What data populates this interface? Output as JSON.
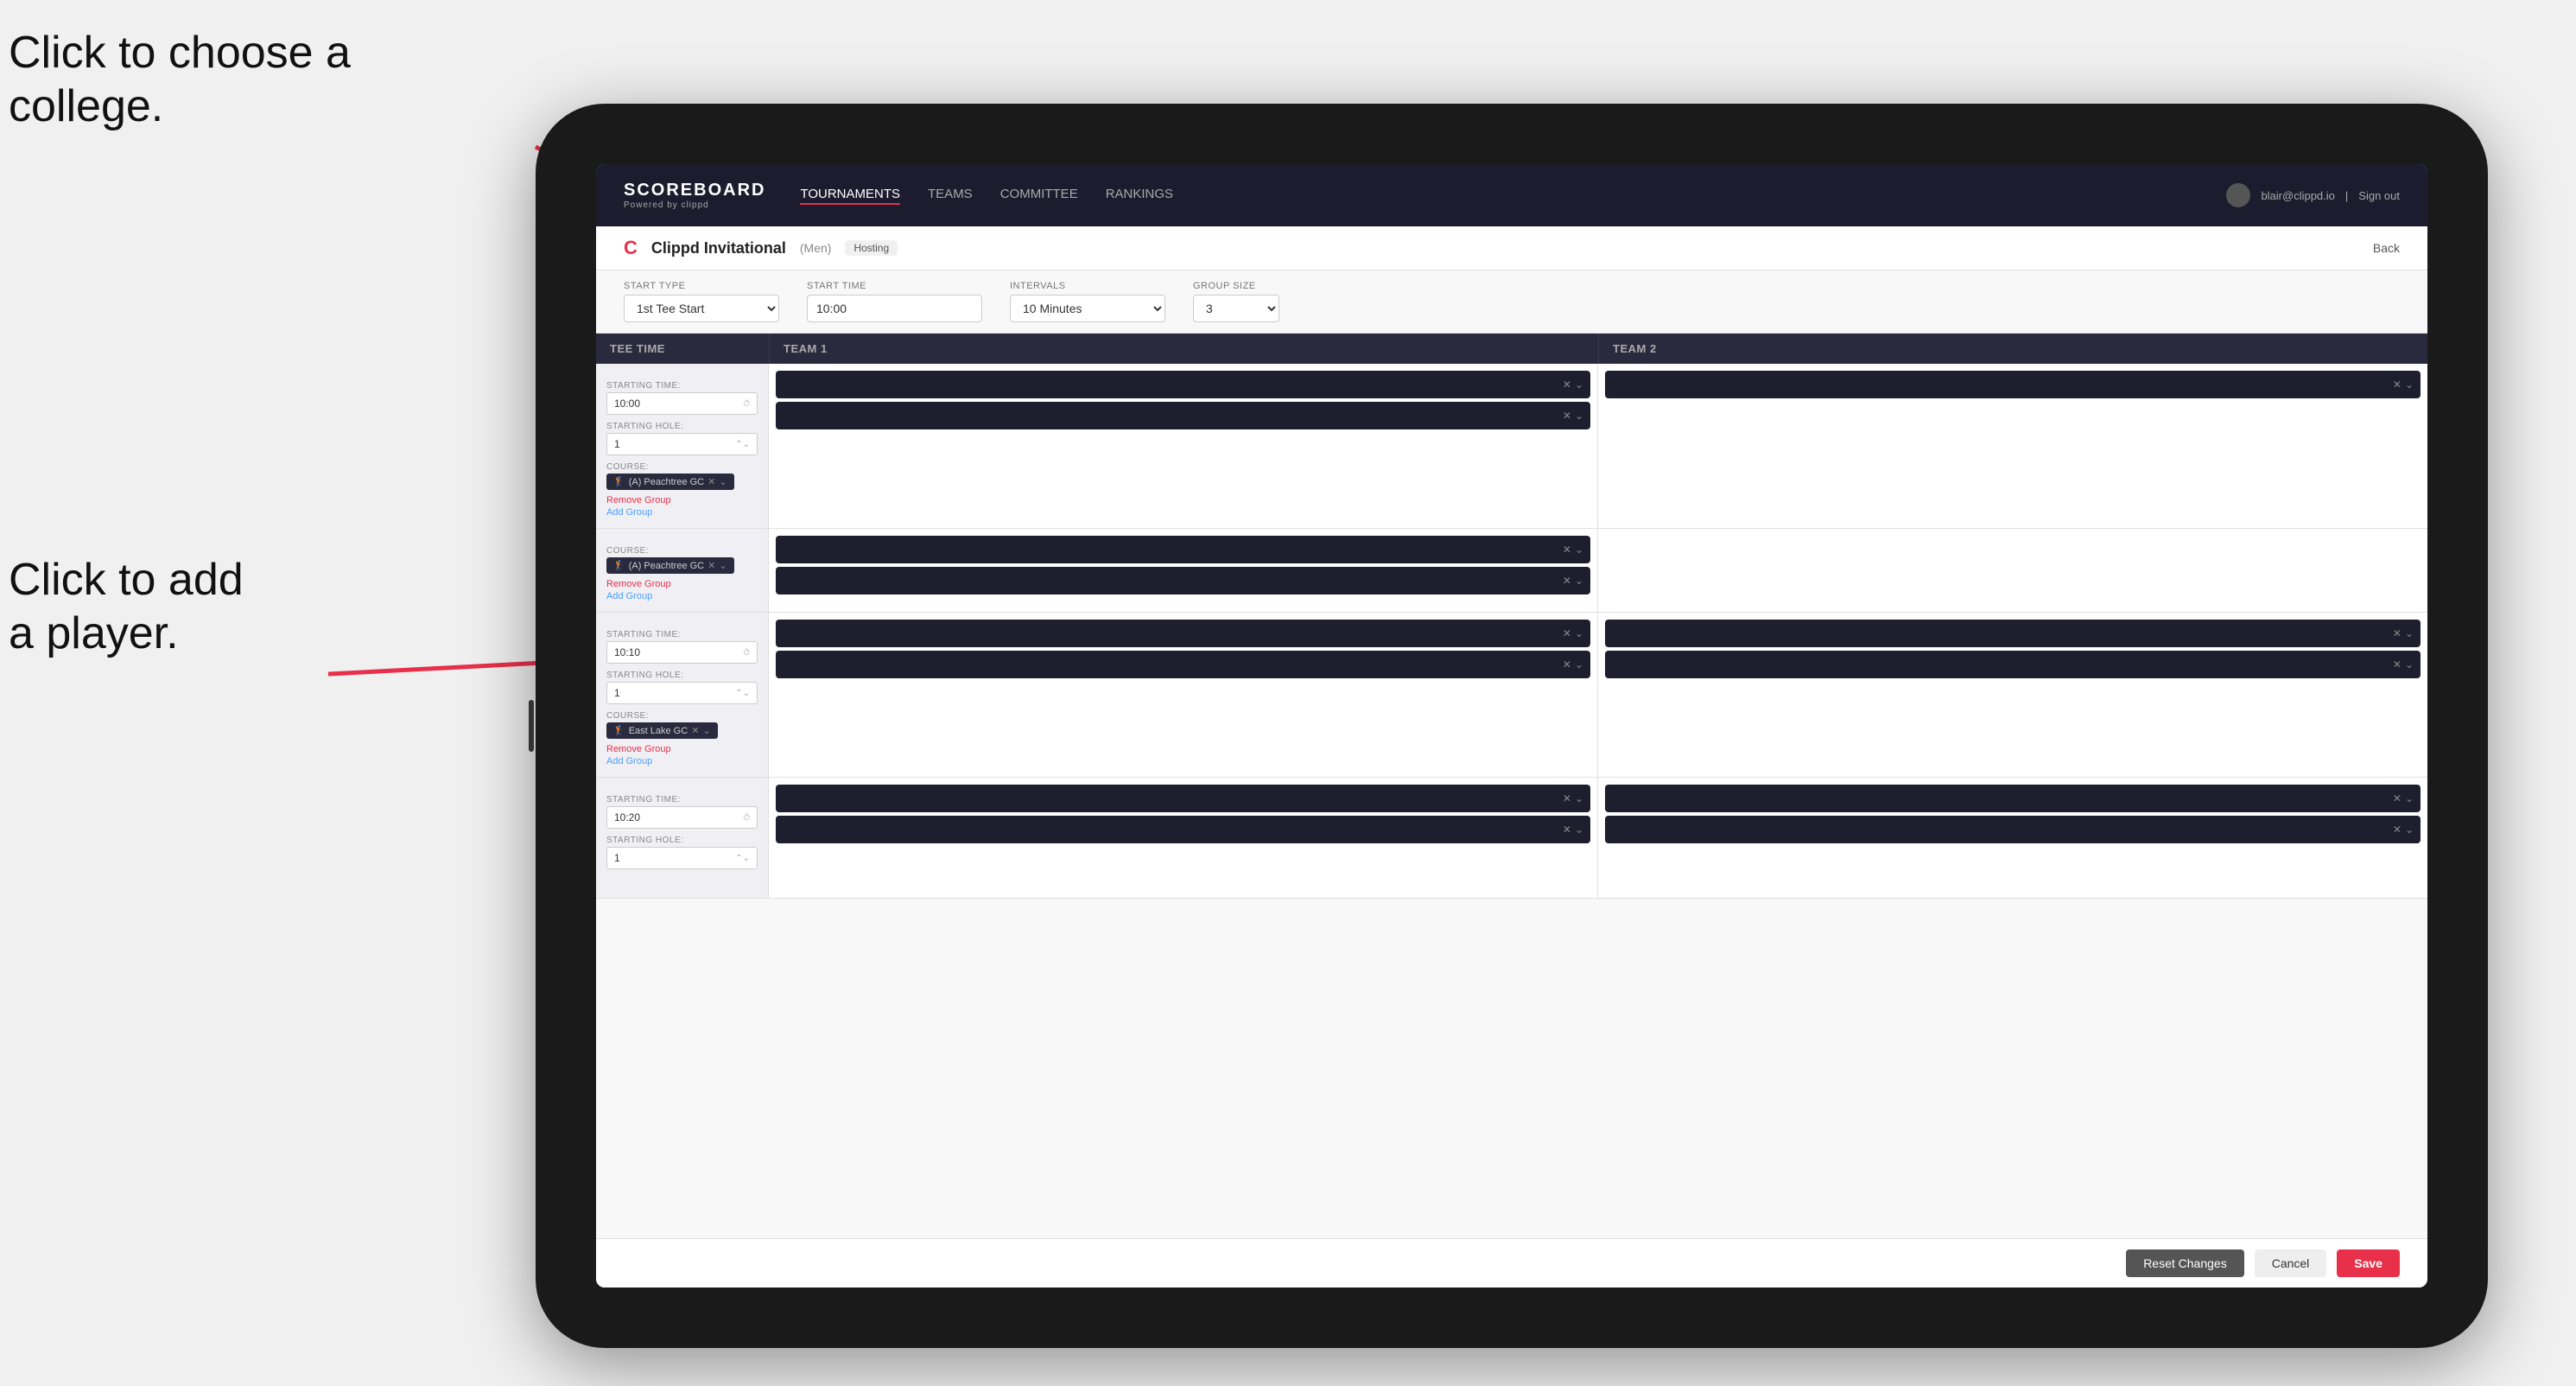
{
  "annotations": {
    "text1_line1": "Click to choose a",
    "text1_line2": "college.",
    "text2_line1": "Click to add",
    "text2_line2": "a player."
  },
  "nav": {
    "logo": "SCOREBOARD",
    "logo_sub": "Powered by clippd",
    "links": [
      "TOURNAMENTS",
      "TEAMS",
      "COMMITTEE",
      "RANKINGS"
    ],
    "active_link": "TOURNAMENTS",
    "user_email": "blair@clippd.io",
    "sign_out": "Sign out"
  },
  "sub_header": {
    "tournament": "Clippd Invitational",
    "gender": "(Men)",
    "hosting": "Hosting",
    "back": "Back"
  },
  "form": {
    "start_type_label": "Start Type",
    "start_type_value": "1st Tee Start",
    "start_time_label": "Start Time",
    "start_time_value": "10:00",
    "intervals_label": "Intervals",
    "intervals_value": "10 Minutes",
    "group_size_label": "Group Size",
    "group_size_value": "3"
  },
  "table_headers": {
    "tee_time": "Tee Time",
    "team1": "Team 1",
    "team2": "Team 2"
  },
  "rows": [
    {
      "starting_time": "10:00",
      "starting_hole": "1",
      "course": "(A) Peachtree GC",
      "has_remove_group": true,
      "has_add_group": true,
      "team1_slots": 2,
      "team2_slots": 1
    },
    {
      "starting_time": "10:10",
      "starting_hole": "1",
      "course": "East Lake GC",
      "has_remove_group": true,
      "has_add_group": true,
      "team1_slots": 2,
      "team2_slots": 2
    },
    {
      "starting_time": "10:20",
      "starting_hole": "1",
      "course": "",
      "has_remove_group": false,
      "has_add_group": false,
      "team1_slots": 2,
      "team2_slots": 2
    }
  ],
  "actions": {
    "reset": "Reset Changes",
    "cancel": "Cancel",
    "save": "Save"
  },
  "labels": {
    "starting_time": "STARTING TIME:",
    "starting_hole": "STARTING HOLE:",
    "course": "COURSE:",
    "remove_group": "Remove Group",
    "add_group": "Add Group"
  }
}
